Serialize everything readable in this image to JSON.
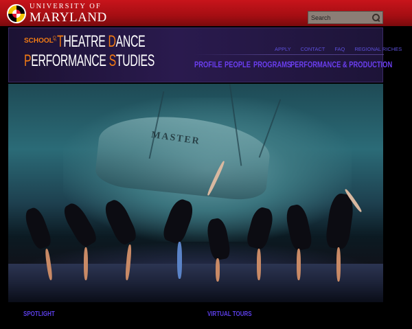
{
  "university": {
    "line1": "UNIVERSITY OF",
    "line2": "MARYLAND"
  },
  "search": {
    "placeholder": "Search"
  },
  "school": {
    "school_word": "SCHOOL",
    "of_word": "OF",
    "title_line1": {
      "t1": "T",
      "t2": "HEATRE ",
      "t3": "D",
      "t4": "ANCE"
    },
    "title_line2": {
      "t1": "P",
      "t2": "ERFORMANCE ",
      "t3": "S",
      "t4": "TUDIES"
    }
  },
  "utility_nav": [
    "APPLY",
    "CONTACT",
    "FAQ",
    "REGIONAL RICHES"
  ],
  "main_nav": [
    "PROFILE",
    "PEOPLE",
    "PROGRAMS",
    "PERFORMANCE & PRODUCTION"
  ],
  "hero": {
    "backdrop_text": "MASTER"
  },
  "footer": {
    "spotlight": "SPOTLIGHT",
    "virtual_tours": "VIRTUAL TOURS"
  },
  "colors": {
    "umd_red": "#c8141b",
    "accent_orange": "#f27b14",
    "nav_purple": "#6b3ef0",
    "header_bg": "#1c1233"
  }
}
